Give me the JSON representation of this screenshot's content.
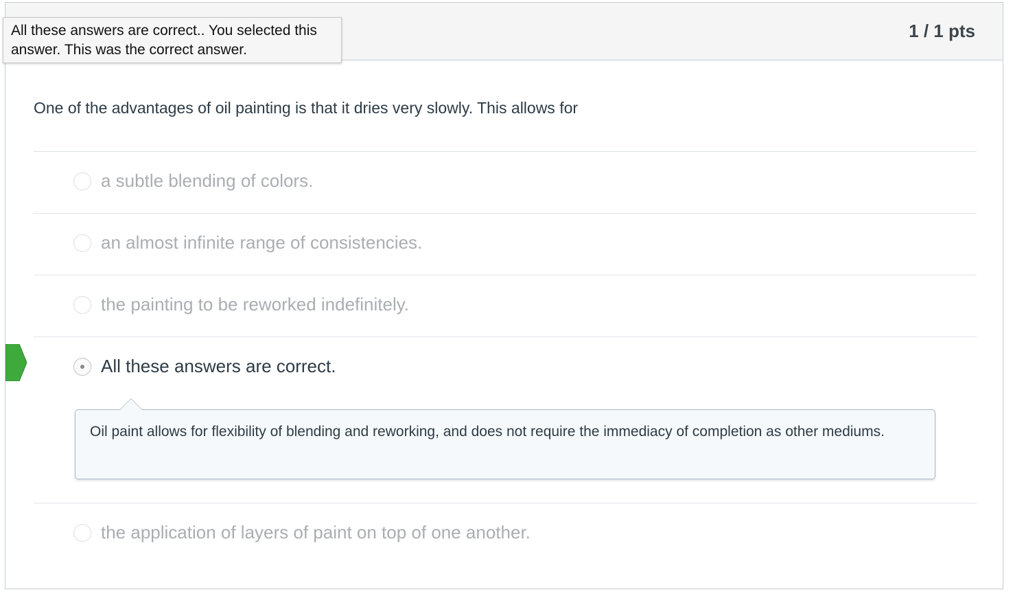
{
  "header": {
    "points": "1 / 1 pts"
  },
  "tooltip": {
    "text": "All these answers are correct.. You selected this answer. This was the correct answer."
  },
  "question": {
    "text": "One of the advantages of oil painting is that it dries very slowly. This allows for"
  },
  "answers": [
    {
      "text": "a subtle blending of colors.",
      "selected": false
    },
    {
      "text": "an almost infinite range of consistencies.",
      "selected": false
    },
    {
      "text": "the painting to be reworked indefinitely.",
      "selected": false
    },
    {
      "text": "All these answers are correct.",
      "selected": true,
      "correct": true
    },
    {
      "text": "the application of layers of paint on top of one another.",
      "selected": false
    }
  ],
  "comment": {
    "text": "Oil paint allows for flexibility of blending and reworking, and does not require the immediacy of completion as other mediums."
  },
  "colors": {
    "correct_marker": "#3eaa3c",
    "selected_text": "#2d3b45",
    "unselected_text": "#a9aeb2",
    "comment_border": "#a7b8c6"
  }
}
